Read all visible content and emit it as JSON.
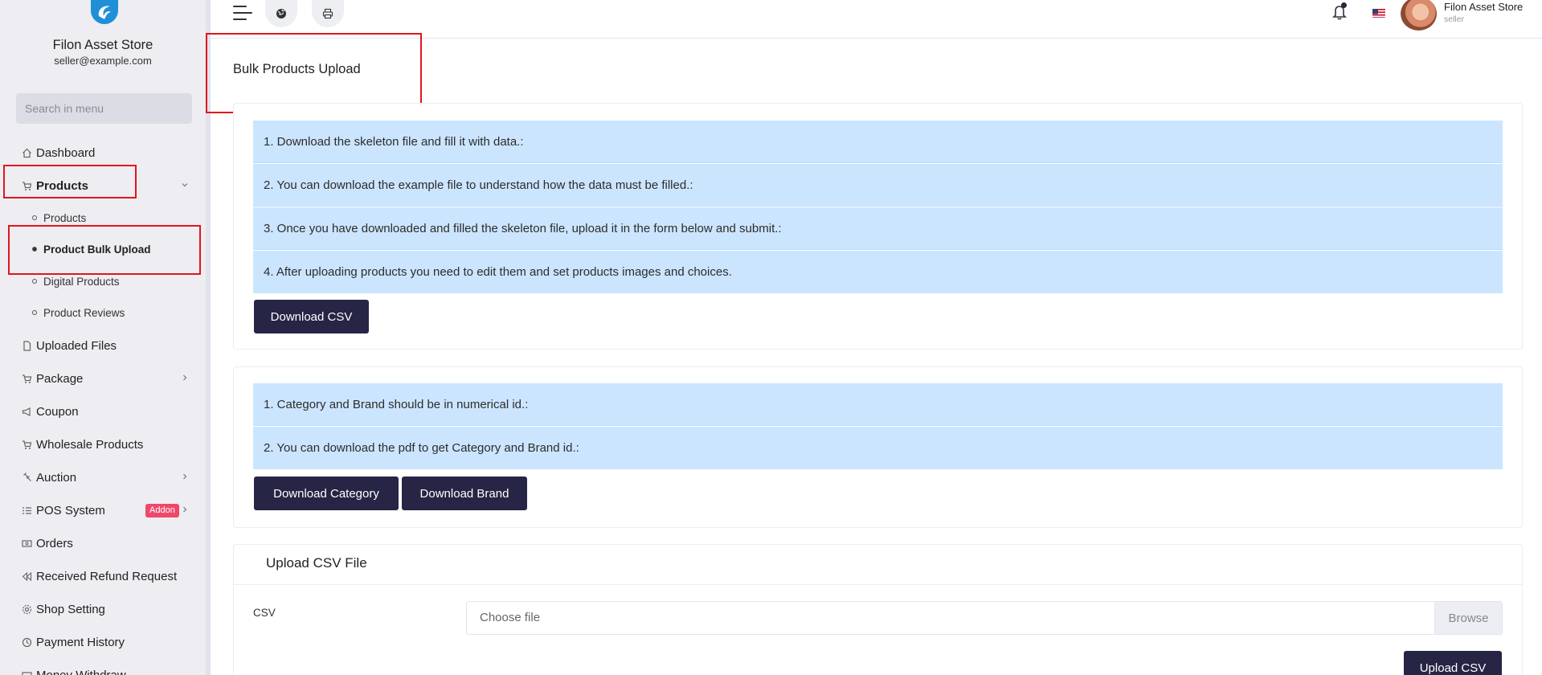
{
  "sidebar": {
    "store_name": "Filon Asset Store",
    "store_email": "seller@example.com",
    "search_placeholder": "Search in menu",
    "items": {
      "dashboard": "Dashboard",
      "products": "Products",
      "products_sub": "Products",
      "product_bulk_upload": "Product Bulk Upload",
      "digital_products": "Digital Products",
      "product_reviews": "Product Reviews",
      "uploaded_files": "Uploaded Files",
      "package": "Package",
      "coupon": "Coupon",
      "wholesale_products": "Wholesale Products",
      "auction": "Auction",
      "pos_system": "POS System",
      "pos_badge": "Addon",
      "orders": "Orders",
      "received_refund_request": "Received Refund Request",
      "shop_setting": "Shop Setting",
      "payment_history": "Payment History",
      "money_withdraw": "Money Withdraw"
    }
  },
  "topbar": {
    "user_name": "Filon Asset Store",
    "user_role": "seller"
  },
  "main": {
    "page_title": "Bulk Products Upload",
    "instructions": [
      "1. Download the skeleton file and fill it with data.:",
      "2. You can download the example file to understand how the data must be filled.:",
      "3. Once you have downloaded and filled the skeleton file, upload it in the form below and submit.:",
      "4. After uploading products you need to edit them and set products images and choices."
    ],
    "download_csv": "Download CSV",
    "id_instructions": [
      "1. Category and Brand should be in numerical id.:",
      "2. You can download the pdf to get Category and Brand id.:"
    ],
    "download_category": "Download Category",
    "download_brand": "Download Brand",
    "upload_title": "Upload CSV File",
    "csv_label": "CSV",
    "file_placeholder": "Choose file",
    "browse": "Browse",
    "upload_csv": "Upload CSV"
  },
  "colors": {
    "primary_button": "#262545",
    "info_background": "#cce5ff",
    "highlight_border": "#e0161e",
    "badge": "#ef486a"
  }
}
